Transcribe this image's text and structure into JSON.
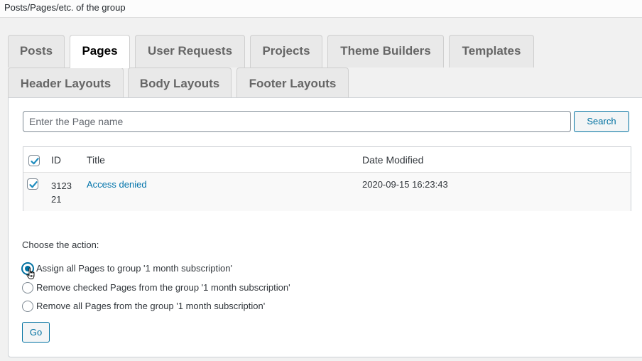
{
  "section": {
    "title": "Posts/Pages/etc. of the group"
  },
  "tabs": [
    {
      "label": "Posts",
      "active": false
    },
    {
      "label": "Pages",
      "active": true
    },
    {
      "label": "User Requests",
      "active": false
    },
    {
      "label": "Projects",
      "active": false
    },
    {
      "label": "Theme Builders",
      "active": false
    },
    {
      "label": "Templates",
      "active": false
    },
    {
      "label": "Header Layouts",
      "active": false
    },
    {
      "label": "Body Layouts",
      "active": false
    },
    {
      "label": "Footer Layouts",
      "active": false
    }
  ],
  "search": {
    "placeholder": "Enter the Page name",
    "value": "",
    "button_label": "Search"
  },
  "table": {
    "select_all_checked": true,
    "columns": [
      "ID",
      "Title",
      "Date Modified"
    ],
    "rows": [
      {
        "checked": true,
        "id_line1": "3123",
        "id_line2": "21",
        "id": "312321",
        "title": "Access denied",
        "date_modified": "2020-09-15 16:23:43"
      }
    ]
  },
  "actions": {
    "label": "Choose the action:",
    "options": [
      {
        "label": "Assign all Pages to group '1 month subscription'",
        "selected": true
      },
      {
        "label": "Remove checked Pages from the group '1 month subscription'",
        "selected": false
      },
      {
        "label": "Remove all Pages from the group '1 month subscription'",
        "selected": false
      }
    ],
    "go_label": "Go"
  },
  "colors": {
    "accent": "#0071a1",
    "link": "#0073aa"
  }
}
